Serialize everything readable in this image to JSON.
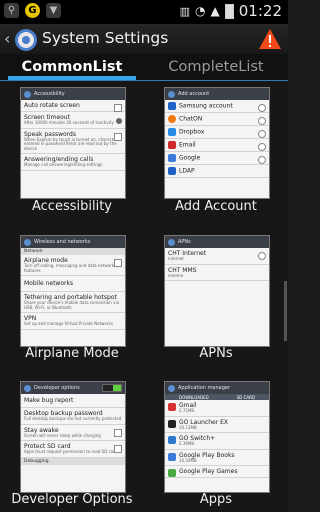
{
  "status_bar": {
    "time": "01:22",
    "icons": [
      "usb-icon",
      "notification-icon",
      "download-icon"
    ]
  },
  "action_bar": {
    "title": "System Settings"
  },
  "tabs": [
    {
      "label": "CommonList",
      "selected": true
    },
    {
      "label": "CompleteList",
      "selected": false
    }
  ],
  "cards": {
    "accessibility": {
      "label": "Accessibility",
      "header": "Accessibility",
      "rows": [
        {
          "title": "Auto rotate screen",
          "sub": ""
        },
        {
          "title": "Screen timeout",
          "sub": "After 10000 minutes 20 seconds of inactivity"
        },
        {
          "title": "Speak passwords",
          "sub": "When Explore by touch is turned on, characters entered in password fields are read out by the device"
        },
        {
          "title": "Answering/ending calls",
          "sub": "Manage call answering/ending settings"
        }
      ]
    },
    "add_account": {
      "label": "Add Account",
      "header": "Add account",
      "rows": [
        "Samsung account",
        "ChatON",
        "Dropbox",
        "Email",
        "Google",
        "LDAP"
      ]
    },
    "airplane": {
      "label": "Airplane Mode",
      "header": "Wireless and networks",
      "section": "Network",
      "rows": [
        {
          "title": "Airplane mode",
          "sub": "Turn off calling, messaging and data network features"
        },
        {
          "title": "Mobile networks",
          "sub": ""
        },
        {
          "title": "Tethering and portable hotspot",
          "sub": "Share your device's mobile data connection via USB, Wi-Fi, or Bluetooth"
        },
        {
          "title": "VPN",
          "sub": "Set up and manage Virtual Private Networks"
        }
      ]
    },
    "apns": {
      "label": "APNs",
      "header": "APNs",
      "rows": [
        {
          "title": "CHT Internet",
          "sub": "internet"
        },
        {
          "title": "CHT MMS",
          "sub": "emome"
        }
      ]
    },
    "developer": {
      "label": "Developer Options",
      "header": "Developer options",
      "rows": [
        {
          "title": "Make bug report",
          "sub": ""
        },
        {
          "title": "Desktop backup password",
          "sub": "Full desktop backups are not currently protected"
        },
        {
          "title": "Stay awake",
          "sub": "Screen will never sleep while charging"
        },
        {
          "title": "Protect SD card",
          "sub": "Apps must request permission to read SD card"
        }
      ],
      "section": "Debugging"
    },
    "apps": {
      "label": "Apps",
      "header": "Application manager",
      "bar": [
        "DOWNLOADED",
        "SD CARD"
      ],
      "rows": [
        {
          "title": "Gmail",
          "sub": "2.71MB"
        },
        {
          "title": "GO Launcher EX",
          "sub": "10.13MB"
        },
        {
          "title": "GO Switch+",
          "sub": "2.39MB"
        },
        {
          "title": "Google Play Books",
          "sub": "10.54MB"
        },
        {
          "title": "Google Play Games",
          "sub": ""
        }
      ]
    }
  }
}
